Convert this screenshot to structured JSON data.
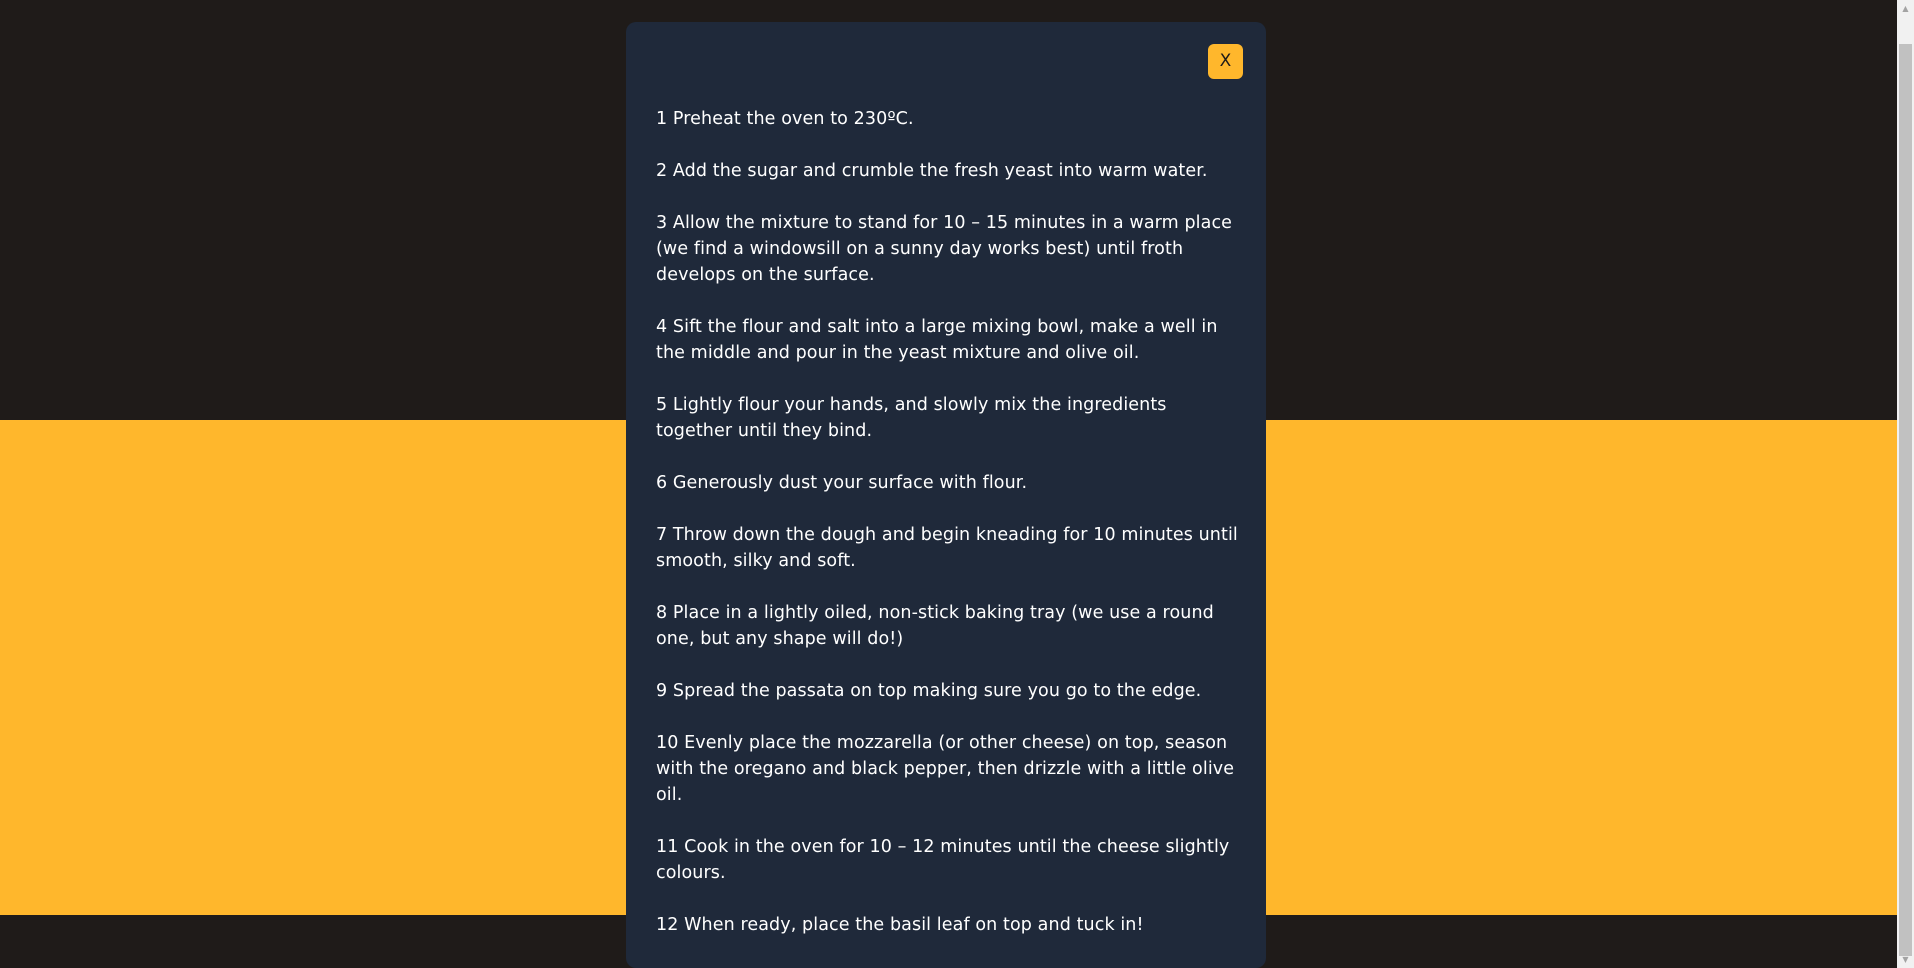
{
  "modal": {
    "close_label": "X",
    "steps": [
      "1 Preheat the oven to 230ºC.",
      "2 Add the sugar and crumble the fresh yeast into warm water.",
      "3 Allow the mixture to stand for 10 – 15 minutes in a warm place (we find a windowsill on a sunny day works best) until froth develops on the surface.",
      "4 Sift the flour and salt into a large mixing bowl, make a well in the middle and pour in the yeast mixture and olive oil.",
      "5 Lightly flour your hands, and slowly mix the ingredients together until they bind.",
      "6 Generously dust your surface with flour.",
      "7 Throw down the dough and begin kneading for 10 minutes until smooth, silky and soft.",
      "8 Place in a lightly oiled, non-stick baking tray (we use a round one, but any shape will do!)",
      "9 Spread the passata on top making sure you go to the edge.",
      "10 Evenly place the mozzarella (or other cheese) on top, season with the oregano and black pepper, then drizzle with a little olive oil.",
      "11 Cook in the oven for 10 – 12 minutes until the cheese slightly colours.",
      "12 When ready, place the basil leaf on top and tuck in!"
    ]
  },
  "colors": {
    "page_dark": "#1f1b19",
    "accent_yellow": "#ffb72c",
    "modal_bg": "#1f293a",
    "text": "#ffffff"
  }
}
